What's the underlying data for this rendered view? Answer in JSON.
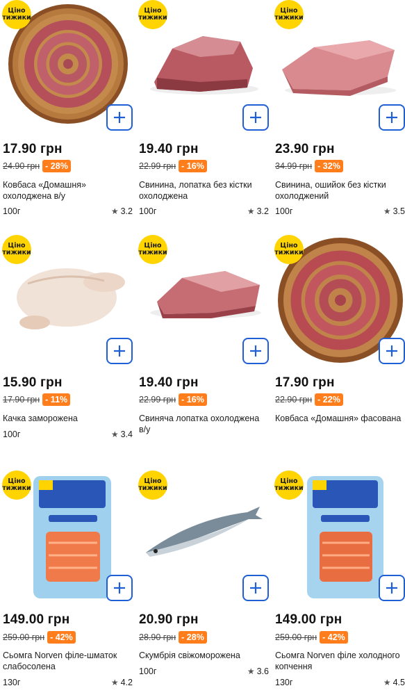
{
  "badge": {
    "line1": "Ціно",
    "line2": "тижики"
  },
  "colors": {
    "accent": "#1f5fd6",
    "discount": "#ff7d1a",
    "badge": "#ffd400"
  },
  "icons": {
    "add": "plus-icon",
    "rating": "star-icon"
  },
  "products": [
    {
      "price": "17.90 грн",
      "old_price": "24.90 грн",
      "discount": "- 28%",
      "name": "Ковбаса «Домашня» охолоджена в/у",
      "weight": "100г",
      "rating": "3.2"
    },
    {
      "price": "19.40 грн",
      "old_price": "22.99 грн",
      "discount": "- 16%",
      "name": "Свинина, лопатка без кістки охолоджена",
      "weight": "100г",
      "rating": "3.2"
    },
    {
      "price": "23.90 грн",
      "old_price": "34.99 грн",
      "discount": "- 32%",
      "name": "Свинина, ошийок без кістки охолоджений",
      "weight": "100г",
      "rating": "3.5"
    },
    {
      "price": "15.90 грн",
      "old_price": "17.90 грн",
      "discount": "- 11%",
      "name": "Качка заморожена",
      "weight": "100г",
      "rating": "3.4"
    },
    {
      "price": "19.40 грн",
      "old_price": "22.99 грн",
      "discount": "- 16%",
      "name": "Свиняча лопатка охолоджена в/у",
      "weight": "",
      "rating": ""
    },
    {
      "price": "17.90 грн",
      "old_price": "22.90 грн",
      "discount": "- 22%",
      "name": "Ковбаса «Домашня» фасована",
      "weight": "",
      "rating": ""
    },
    {
      "price": "149.00 грн",
      "old_price": "259.00 грн",
      "discount": "- 42%",
      "name": "Сьомга Norven філе-шматок слабосолена",
      "weight": "130г",
      "rating": "4.2"
    },
    {
      "price": "20.90 грн",
      "old_price": "28.90 грн",
      "discount": "- 28%",
      "name": "Скумбрія свіжоморожена",
      "weight": "100г",
      "rating": "3.6"
    },
    {
      "price": "149.00 грн",
      "old_price": "259.00 грн",
      "discount": "- 42%",
      "name": "Сьомга Norven філе холодного копчення",
      "weight": "130г",
      "rating": "4.5"
    }
  ]
}
